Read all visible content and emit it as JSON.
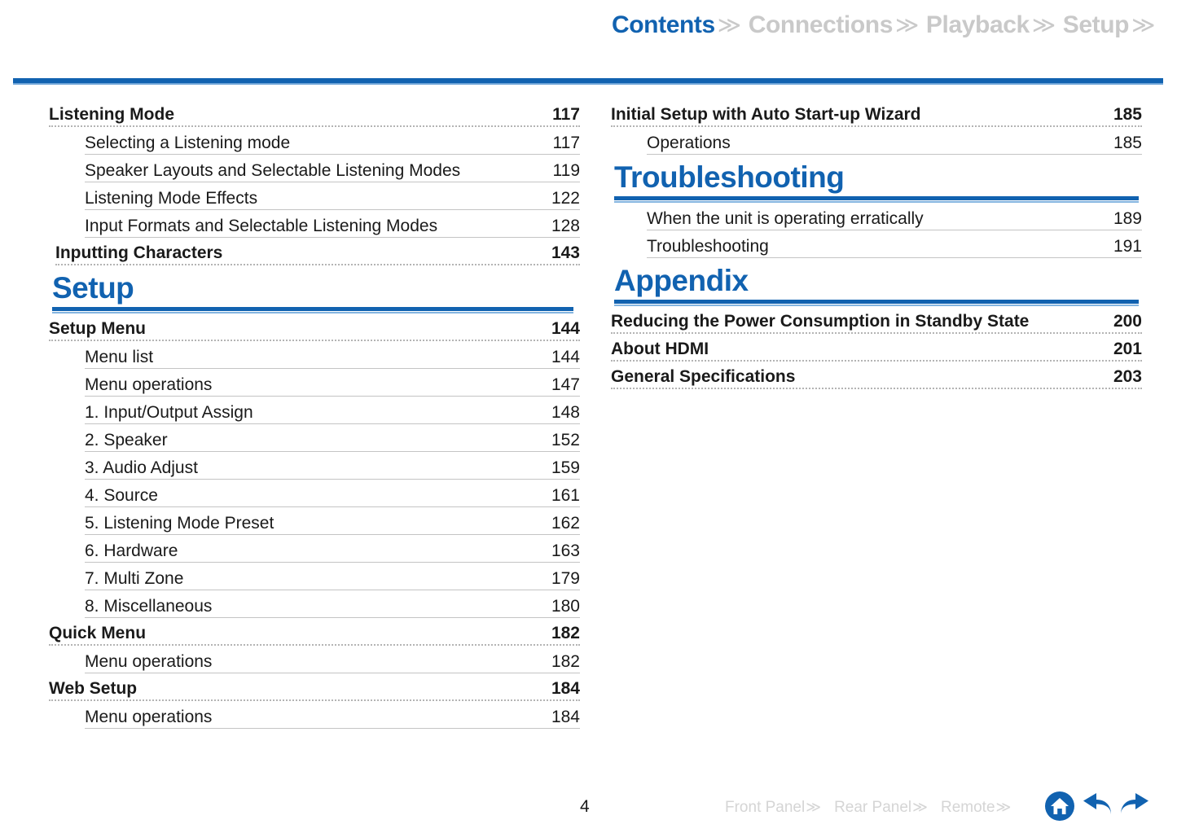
{
  "top_nav": {
    "tabs": [
      {
        "label": "Contents",
        "chevron": "≫",
        "active": true
      },
      {
        "label": "Connections",
        "chevron": "≫",
        "active": false
      },
      {
        "label": "Playback",
        "chevron": "≫",
        "active": false
      },
      {
        "label": "Setup",
        "chevron": "≫",
        "active": false
      }
    ]
  },
  "colors": {
    "accent_blue": "#1162b0",
    "rule_light_blue": "#6fa5d8",
    "inactive_gray": "#c9c9c9",
    "footer_gray": "#d5d5d5",
    "text": "#1a1a1a"
  },
  "left_column": [
    {
      "kind": "entry",
      "level": 1,
      "title": "Listening Mode",
      "page": "117"
    },
    {
      "kind": "entry",
      "level": 2,
      "title": "Selecting a Listening mode",
      "page": "117"
    },
    {
      "kind": "entry",
      "level": 2,
      "title": "Speaker Layouts and Selectable Listening Modes",
      "page": "119"
    },
    {
      "kind": "entry",
      "level": 2,
      "title": "Listening Mode Effects",
      "page": "122"
    },
    {
      "kind": "entry",
      "level": 2,
      "title": "Input Formats and Selectable Listening Modes",
      "page": "128"
    },
    {
      "kind": "entry",
      "level": 1,
      "title": "Inputting Characters",
      "page": "143",
      "indent": true
    },
    {
      "kind": "section",
      "title": "Setup"
    },
    {
      "kind": "entry",
      "level": 1,
      "title": "Setup Menu",
      "page": "144"
    },
    {
      "kind": "entry",
      "level": 2,
      "title": "Menu list",
      "page": "144"
    },
    {
      "kind": "entry",
      "level": 2,
      "title": "Menu operations",
      "page": "147"
    },
    {
      "kind": "entry",
      "level": 2,
      "title": "1. Input/Output Assign",
      "page": "148"
    },
    {
      "kind": "entry",
      "level": 2,
      "title": "2. Speaker",
      "page": "152"
    },
    {
      "kind": "entry",
      "level": 2,
      "title": "3. Audio Adjust",
      "page": "159"
    },
    {
      "kind": "entry",
      "level": 2,
      "title": "4. Source",
      "page": "161"
    },
    {
      "kind": "entry",
      "level": 2,
      "title": "5. Listening Mode Preset",
      "page": "162"
    },
    {
      "kind": "entry",
      "level": 2,
      "title": "6. Hardware",
      "page": "163"
    },
    {
      "kind": "entry",
      "level": 2,
      "title": "7. Multi Zone",
      "page": "179"
    },
    {
      "kind": "entry",
      "level": 2,
      "title": "8. Miscellaneous",
      "page": "180"
    },
    {
      "kind": "entry",
      "level": 1,
      "title": "Quick Menu",
      "page": "182"
    },
    {
      "kind": "entry",
      "level": 2,
      "title": "Menu operations",
      "page": "182"
    },
    {
      "kind": "entry",
      "level": 1,
      "title": "Web Setup",
      "page": "184"
    },
    {
      "kind": "entry",
      "level": 2,
      "title": "Menu operations",
      "page": "184"
    }
  ],
  "right_column": [
    {
      "kind": "entry",
      "level": 1,
      "title": "Initial Setup with Auto Start-up Wizard",
      "page": "185"
    },
    {
      "kind": "entry",
      "level": 2,
      "title": "Operations",
      "page": "185"
    },
    {
      "kind": "section",
      "title": "Troubleshooting"
    },
    {
      "kind": "entry",
      "level": 2,
      "title": "When the unit is operating erratically",
      "page": "189"
    },
    {
      "kind": "entry",
      "level": 2,
      "title": "Troubleshooting",
      "page": "191"
    },
    {
      "kind": "section",
      "title": "Appendix"
    },
    {
      "kind": "entry",
      "level": 1,
      "title": "Reducing the Power Consumption in Standby State",
      "page": "200"
    },
    {
      "kind": "entry",
      "level": 1,
      "title": "About HDMI",
      "page": "201"
    },
    {
      "kind": "entry",
      "level": 1,
      "title": "General Specifications",
      "page": "203"
    }
  ],
  "footer": {
    "page_number": "4",
    "links": [
      {
        "label": "Front Panel",
        "chevron": "≫"
      },
      {
        "label": "Rear Panel",
        "chevron": "≫"
      },
      {
        "label": "Remote",
        "chevron": "≫"
      }
    ],
    "icons": [
      {
        "name": "home-icon"
      },
      {
        "name": "back-arrow-icon"
      },
      {
        "name": "forward-arrow-icon"
      }
    ]
  }
}
